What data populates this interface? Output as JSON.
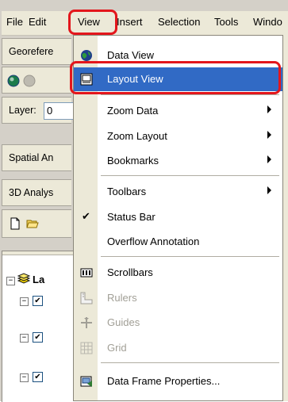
{
  "menubar": {
    "file": "File",
    "edit": "Edit",
    "view": "View",
    "insert": "Insert",
    "selection": "Selection",
    "tools": "Tools",
    "window_partial": "Windo"
  },
  "left_panels": {
    "georef": "Georefere",
    "layer_label": "Layer:",
    "layer_value": "0",
    "spatial": "Spatial An",
    "analyst3d": "3D Analys",
    "tree_label": "La"
  },
  "view_menu": {
    "items": [
      {
        "label": "Data View",
        "icon": "data-view-globe-icon",
        "state": "normal"
      },
      {
        "label": "Layout View",
        "icon": "layout-view-page-icon",
        "state": "selected"
      },
      {
        "label": "Zoom Data",
        "submenu": true
      },
      {
        "label": "Zoom Layout",
        "submenu": true
      },
      {
        "label": "Bookmarks",
        "submenu": true
      },
      {
        "label": "Toolbars",
        "submenu": true
      },
      {
        "label": "Status Bar",
        "checked": true
      },
      {
        "label": "Overflow Annotation"
      },
      {
        "label": "Scrollbars",
        "icon": "scrollbars-icon"
      },
      {
        "label": "Rulers",
        "icon": "rulers-icon",
        "state": "disabled"
      },
      {
        "label": "Guides",
        "icon": "guides-icon",
        "state": "disabled"
      },
      {
        "label": "Grid",
        "icon": "grid-icon",
        "state": "disabled"
      },
      {
        "label": "Data Frame Properties...",
        "icon": "data-frame-properties-icon"
      }
    ]
  },
  "colors": {
    "highlight_ring": "#e3161c",
    "selection": "#316ac5",
    "menu_chrome": "#ece9d8"
  }
}
